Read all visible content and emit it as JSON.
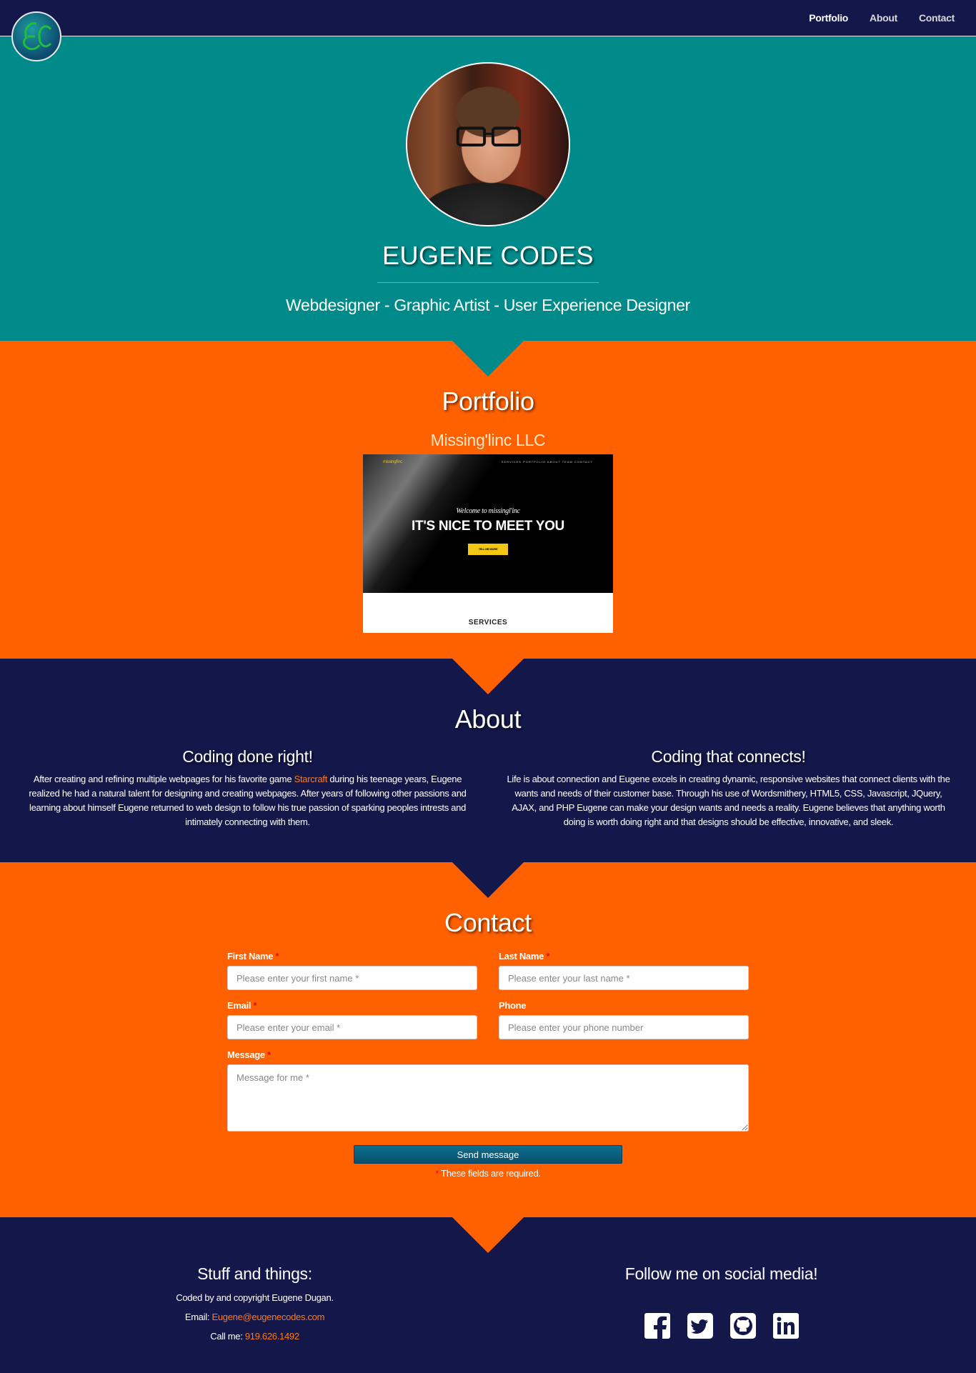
{
  "nav": {
    "logo_text": "EC",
    "links": [
      "Portfolio",
      "About",
      "Contact"
    ]
  },
  "hero": {
    "title": "EUGENE CODES",
    "subtitle": "Webdesigner - Graphic Artist - User Experience Designer"
  },
  "portfolio": {
    "title": "Portfolio",
    "project_title": "Missing'linc LLC",
    "screenshot": {
      "brand": "missingl'inc",
      "menu": "SERVICES PORTFOLIO ABOUT TEAM CONTACT",
      "welcome": "Welcome to missingl'inc",
      "headline": "IT'S NICE TO MEET YOU",
      "cta": "TELL ME MORE",
      "section": "SERVICES"
    }
  },
  "about": {
    "title": "About",
    "col1": {
      "heading": "Coding done right!",
      "text_before": "After creating and refining multiple webpages for his favorite game ",
      "link": "Starcraft",
      "text_after": " during his teenage years, Eugene realized he had a natural talent for designing and creating webpages. After years of following other passions and learning about himself Eugene returned to web design to follow his true passion of sparking peoples intrests and intimately connecting with them."
    },
    "col2": {
      "heading": "Coding that connects!",
      "text": "Life is about connection and Eugene excels in creating dynamic, responsive websites that connect clients with the wants and needs of their customer base. Through his use of Wordsmithery, HTML5, CSS, Javascript, JQuery, AJAX, and PHP Eugene can make your design wants and needs a reality. Eugene believes that anything worth doing is worth doing right and that designs should be effective, innovative, and sleek."
    }
  },
  "contact": {
    "title": "Contact",
    "first_name": {
      "label": "First Name",
      "placeholder": "Please enter your first name *"
    },
    "last_name": {
      "label": "Last Name",
      "placeholder": "Please enter your last name *"
    },
    "email": {
      "label": "Email",
      "placeholder": "Please enter your email *"
    },
    "phone": {
      "label": "Phone",
      "placeholder": "Please enter your phone number"
    },
    "message": {
      "label": "Message",
      "placeholder": "Message for me *"
    },
    "required_mark": "*",
    "send_label": "Send message",
    "required_note": "These fields are required."
  },
  "footer": {
    "left_title": "Stuff and things:",
    "copyright": "Coded by and copyright Eugene Dugan.",
    "email_label": "Email: ",
    "email": "Eugene@eugenecodes.com",
    "phone_label": "Call me: ",
    "phone": "919.626.1492",
    "right_title": "Follow me on social media!",
    "socials": [
      "facebook-icon",
      "twitter-icon",
      "github-icon",
      "linkedin-icon"
    ]
  },
  "colors": {
    "navy": "#14174a",
    "teal": "#008a8a",
    "orange": "#ff6000",
    "link_orange": "#ff7a1a",
    "required_red": "#e01010"
  }
}
